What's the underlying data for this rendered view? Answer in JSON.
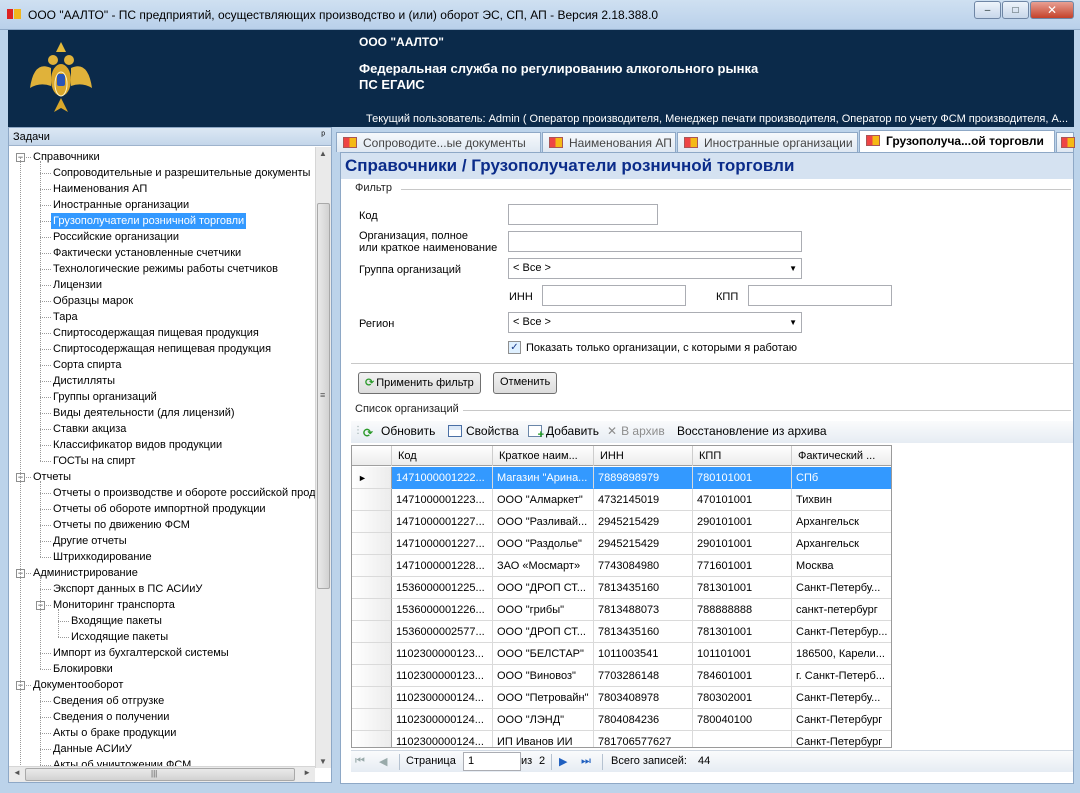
{
  "window": {
    "title": "ООО \"ААЛТО\" - ПС предприятий, осуществляющих производство и (или) оборот ЭС, СП, АП - Версия 2.18.388.0",
    "buttons": {
      "minimize": "–",
      "maximize": "□",
      "close": "✕"
    }
  },
  "header": {
    "org": "ООО \"ААЛТО\"",
    "service": "Федеральная служба по регулированию алкогольного рынка",
    "system": "ПС ЕГАИС",
    "user": "Текущий пользователь: Admin ( Оператор производителя, Менеджер печати производителя, Оператор по учету ФСМ производителя, А..."
  },
  "sidebar": {
    "title": "Задачи",
    "pin": "ᵖ",
    "selected": "Грузополучатели розничной торговли",
    "tree": [
      {
        "label": "Справочники",
        "level": 0,
        "toggle": "−"
      },
      {
        "label": "Сопроводительные и разрешительные документы",
        "level": 1
      },
      {
        "label": "Наименования АП",
        "level": 1
      },
      {
        "label": "Иностранные организации",
        "level": 1
      },
      {
        "label": "Грузополучатели розничной торговли",
        "level": 1
      },
      {
        "label": "Российские организации",
        "level": 1
      },
      {
        "label": "Фактически установленные счетчики",
        "level": 1
      },
      {
        "label": "Технологические режимы работы счетчиков",
        "level": 1
      },
      {
        "label": "Лицензии",
        "level": 1
      },
      {
        "label": "Образцы марок",
        "level": 1
      },
      {
        "label": "Тара",
        "level": 1
      },
      {
        "label": "Спиртосодержащая пищевая продукция",
        "level": 1
      },
      {
        "label": "Спиртосодержащая непищевая продукция",
        "level": 1
      },
      {
        "label": "Сорта спирта",
        "level": 1
      },
      {
        "label": "Дистилляты",
        "level": 1
      },
      {
        "label": "Группы организаций",
        "level": 1
      },
      {
        "label": "Виды деятельности (для лицензий)",
        "level": 1
      },
      {
        "label": "Ставки акциза",
        "level": 1
      },
      {
        "label": "Классификатор видов продукции",
        "level": 1
      },
      {
        "label": "ГОСТы на спирт",
        "level": 1
      },
      {
        "label": "Отчеты",
        "level": 0,
        "toggle": "−"
      },
      {
        "label": "Отчеты о производстве и обороте российской прод",
        "level": 1
      },
      {
        "label": "Отчеты об обороте импортной продукции",
        "level": 1
      },
      {
        "label": "Отчеты по движению ФСМ",
        "level": 1
      },
      {
        "label": "Другие отчеты",
        "level": 1
      },
      {
        "label": "Штрихкодирование",
        "level": 1
      },
      {
        "label": "Администрирование",
        "level": 0,
        "toggle": "−"
      },
      {
        "label": "Экспорт данных в ПС АСИиУ",
        "level": 1
      },
      {
        "label": "Мониторинг транспорта",
        "level": 1,
        "toggle": "−"
      },
      {
        "label": "Входящие пакеты",
        "level": 2
      },
      {
        "label": "Исходящие пакеты",
        "level": 2
      },
      {
        "label": "Импорт из бухгалтерской системы",
        "level": 1
      },
      {
        "label": "Блокировки",
        "level": 1
      },
      {
        "label": "Документооборот",
        "level": 0,
        "toggle": "−"
      },
      {
        "label": "Сведения об отгрузке",
        "level": 1
      },
      {
        "label": "Сведения о получении",
        "level": 1
      },
      {
        "label": "Акты о браке продукции",
        "level": 1
      },
      {
        "label": "Данные АСИиУ",
        "level": 1
      },
      {
        "label": "Акты об уничтожении ФСМ",
        "level": 1
      }
    ],
    "scroll_grip": "≡",
    "hscroll_grip": "|||"
  },
  "tabs": [
    {
      "label": "Сопроводите...ые документы"
    },
    {
      "label": "Наименования АП"
    },
    {
      "label": "Иностранные организации"
    },
    {
      "label": "Грузополуча...ой торговли",
      "active": true
    }
  ],
  "page": {
    "title": "Справочники / Грузополучатели розничной торговли",
    "filter": {
      "legend": "Фильтр",
      "code_label": "Код",
      "code_value": "",
      "org_label_1": "Организация, полное",
      "org_label_2": "или краткое наименование",
      "org_value": "",
      "group_label": "Группа организаций",
      "group_value": "< Все >",
      "inn_label": "ИНН",
      "inn_value": "",
      "kpp_label": "КПП",
      "kpp_value": "",
      "region_label": "Регион",
      "region_value": "< Все >",
      "only_mine_label": "Показать только организации, с которыми я работаю",
      "only_mine_checked": true,
      "apply_label": "Применить фильтр",
      "cancel_label": "Отменить"
    },
    "list": {
      "legend": "Список организаций",
      "toolbar": {
        "refresh": "Обновить",
        "properties": "Свойства",
        "add": "Добавить",
        "archive": "В архив",
        "restore": "Восстановление из архива"
      },
      "columns": [
        "Код",
        "Краткое наим...",
        "ИНН",
        "КПП",
        "Фактический ..."
      ],
      "rows": [
        [
          "1471000001222...",
          "Магазин \"Арина...",
          "7889898979",
          "780101001",
          "СПб"
        ],
        [
          "1471000001223...",
          "ООО \"Алмаркет\"",
          "4732145019",
          "470101001",
          "Тихвин"
        ],
        [
          "1471000001227...",
          "ООО \"Разливай...",
          "2945215429",
          "290101001",
          "Архангельск"
        ],
        [
          "1471000001227...",
          "ООО \"Раздолье\"",
          "2945215429",
          "290101001",
          "Архангельск"
        ],
        [
          "1471000001228...",
          "ЗАО «Мосмарт»",
          "7743084980",
          "771601001",
          "Москва"
        ],
        [
          "1536000001225...",
          "ООО \"ДРОП СТ...",
          "7813435160",
          "781301001",
          "Санкт-Петербу..."
        ],
        [
          "1536000001226...",
          "ООО \"грибы\"",
          "7813488073",
          "788888888",
          "санкт-петербург"
        ],
        [
          "1536000002577...",
          "ООО \"ДРОП СТ...",
          "7813435160",
          "781301001",
          "Санкт-Петербур..."
        ],
        [
          "1102300000123...",
          "ООО \"БЕЛСТАР\"",
          "1011003541",
          "101101001",
          "186500, Карели..."
        ],
        [
          "1102300000123...",
          "ООО \"Виновоз\"",
          "7703286148",
          "784601001",
          "г. Санкт-Петерб..."
        ],
        [
          "1102300000124...",
          "ООО \"Петровайн\"",
          "7803408978",
          "780302001",
          "Санкт-Петербу..."
        ],
        [
          "1102300000124...",
          "ООО \"ЛЭНД\"",
          "7804084236",
          "780040100",
          "Санкт-Петербург"
        ],
        [
          "1102300000124...",
          "ИП Иванов ИИ",
          "781706577627",
          "",
          "Санкт-Петербург"
        ]
      ],
      "row_marker": "►"
    },
    "pager": {
      "page_label": "Страница",
      "page_value": "1",
      "of_label": "из",
      "total_pages": "2",
      "total_label": "Всего записей:",
      "total_records": "44",
      "first": "⏮",
      "prev": "◀",
      "next": "▶",
      "last": "⏭"
    }
  }
}
